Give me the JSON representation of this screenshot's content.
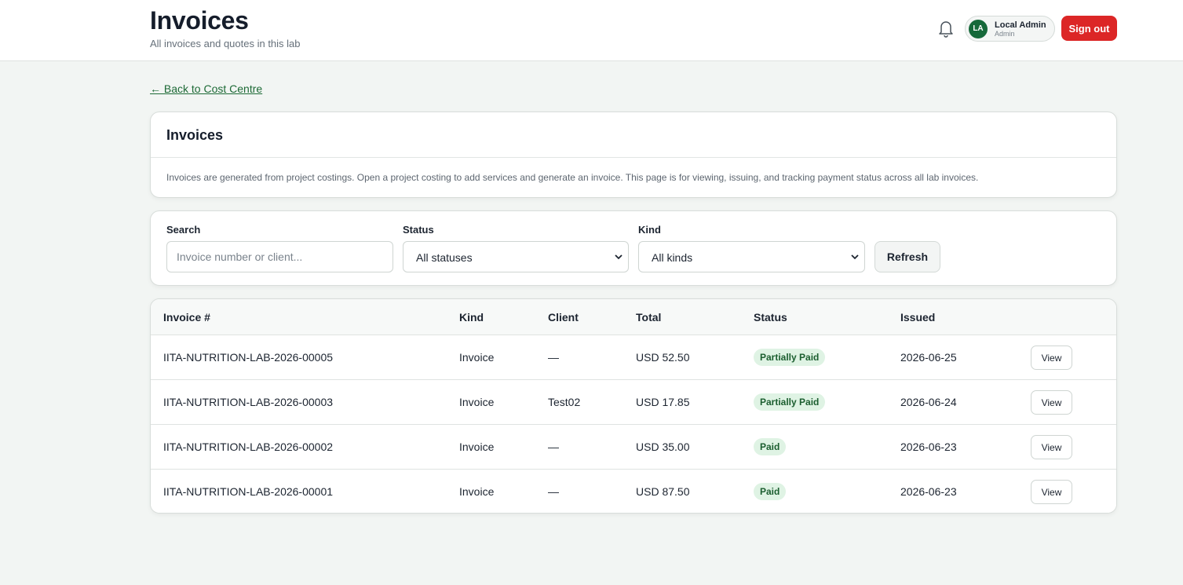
{
  "header": {
    "title": "Invoices",
    "subtitle": "All invoices and quotes in this lab",
    "user": {
      "initials": "LA",
      "name": "Local Admin",
      "role": "Admin"
    },
    "signout_label": "Sign out"
  },
  "nav": {
    "back_label": "← Back to Cost Centre"
  },
  "intro": {
    "title": "Invoices",
    "description": "Invoices are generated from project costings. Open a project costing to add services and generate an invoice. This page is for viewing, issuing, and tracking payment status across all lab invoices."
  },
  "filters": {
    "search_label": "Search",
    "search_placeholder": "Invoice number or client...",
    "search_value": "",
    "status_label": "Status",
    "status_value": "All statuses",
    "kind_label": "Kind",
    "kind_value": "All kinds",
    "refresh_label": "Refresh"
  },
  "table": {
    "columns": [
      "Invoice #",
      "Kind",
      "Client",
      "Total",
      "Status",
      "Issued"
    ],
    "view_label": "View",
    "rows": [
      {
        "number": "IITA-NUTRITION-LAB-2026-00005",
        "kind": "Invoice",
        "client": "—",
        "total": "USD 52.50",
        "status": "Partially Paid",
        "issued": "2026-06-25"
      },
      {
        "number": "IITA-NUTRITION-LAB-2026-00003",
        "kind": "Invoice",
        "client": "Test02",
        "total": "USD 17.85",
        "status": "Partially Paid",
        "issued": "2026-06-24"
      },
      {
        "number": "IITA-NUTRITION-LAB-2026-00002",
        "kind": "Invoice",
        "client": "—",
        "total": "USD 35.00",
        "status": "Paid",
        "issued": "2026-06-23"
      },
      {
        "number": "IITA-NUTRITION-LAB-2026-00001",
        "kind": "Invoice",
        "client": "—",
        "total": "USD 87.50",
        "status": "Paid",
        "issued": "2026-06-23"
      }
    ]
  },
  "colors": {
    "brand_green": "#16693a",
    "danger_red": "#dc2626",
    "badge_bg": "#dff3e4",
    "badge_text": "#1b5e2f",
    "page_bg": "#f2f5f3"
  },
  "icons": {
    "notifications": "bell-icon",
    "select_arrow": "chevron-down-icon"
  }
}
